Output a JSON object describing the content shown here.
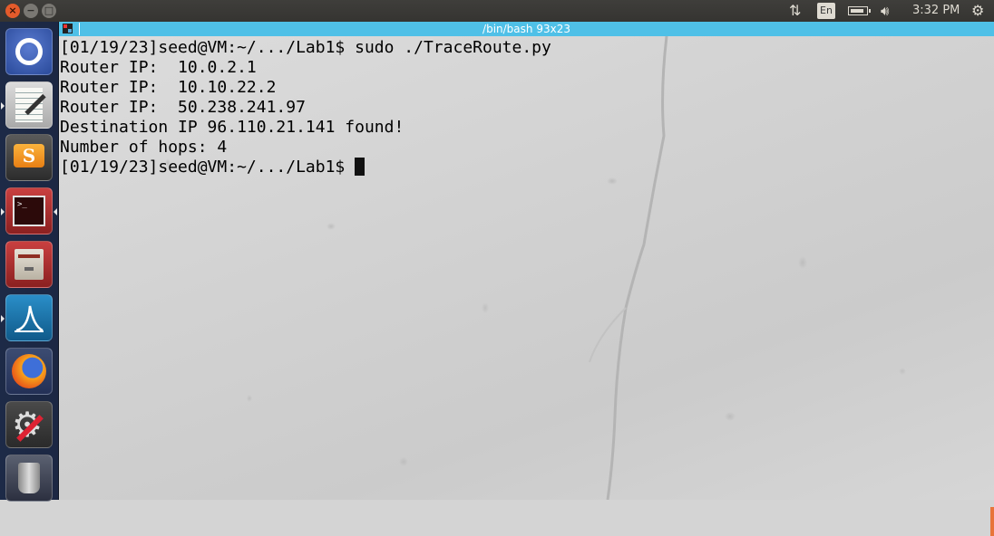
{
  "window_controls": {
    "close_glyph": "×",
    "minimize_glyph": "−",
    "maximize_glyph": "□"
  },
  "top_panel": {
    "network_icon": "network-updown-icon",
    "keyboard_layout": "En",
    "battery_icon": "battery-icon",
    "volume_icon": "volume-icon",
    "clock": "3:32 PM",
    "settings_icon": "power-gear-icon"
  },
  "launcher": {
    "items": [
      {
        "name": "dash",
        "icon": "ubuntu-logo-icon"
      },
      {
        "name": "text-editor",
        "icon": "text-editor-icon"
      },
      {
        "name": "sublime-text",
        "icon": "sublime-text-icon",
        "glyph": "S"
      },
      {
        "name": "terminal",
        "icon": "terminal-icon",
        "glyph": ">_"
      },
      {
        "name": "files",
        "icon": "file-cabinet-icon"
      },
      {
        "name": "wireshark",
        "icon": "wireshark-icon"
      },
      {
        "name": "firefox",
        "icon": "firefox-icon"
      },
      {
        "name": "system-settings",
        "icon": "settings-icon"
      },
      {
        "name": "trash",
        "icon": "trash-icon"
      }
    ]
  },
  "terminal": {
    "title": "/bin/bash 93x23",
    "lines": [
      "[01/19/23]seed@VM:~/.../Lab1$ sudo ./TraceRoute.py",
      "Router IP:  10.0.2.1",
      "Router IP:  10.10.22.2",
      "Router IP:  50.238.241.97",
      "Destination IP 96.110.21.141 found!",
      "Number of hops: 4"
    ],
    "prompt": "[01/19/23]seed@VM:~/.../Lab1$"
  }
}
